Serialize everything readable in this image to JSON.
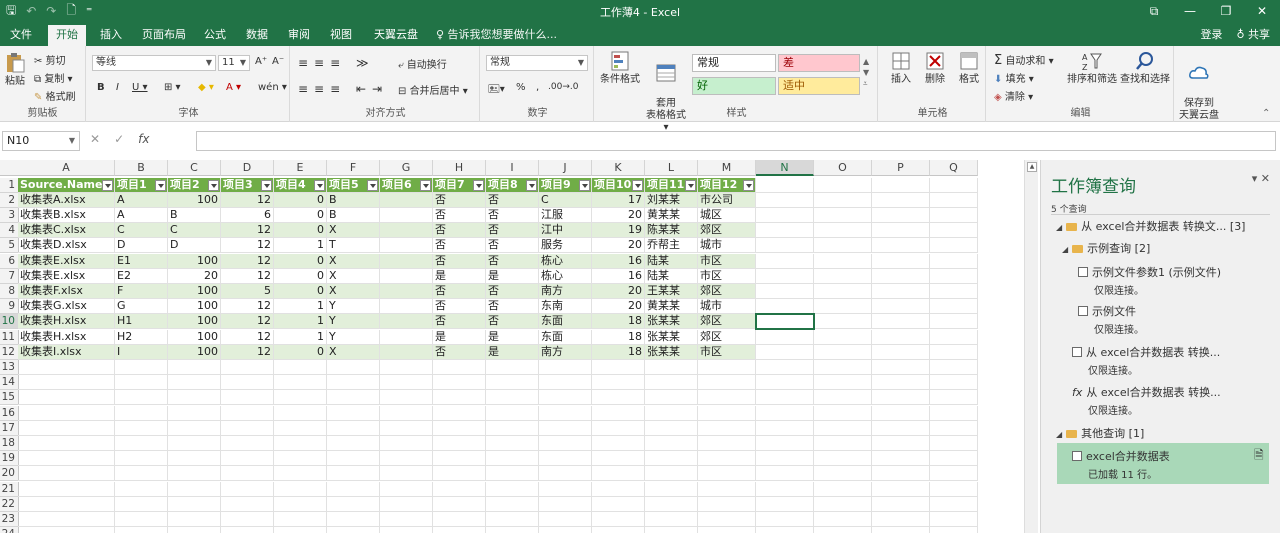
{
  "window": {
    "title": "工作薄4 - Excel"
  },
  "qat": {
    "save": "🖫",
    "undo": "↶",
    "redo": "↷",
    "new": "🗋",
    "more": "⁼"
  },
  "window_buttons": [
    "⧉",
    "—",
    "❐",
    "✕"
  ],
  "tabs": [
    "文件",
    "开始",
    "插入",
    "页面布局",
    "公式",
    "数据",
    "审阅",
    "视图",
    "天翼云盘"
  ],
  "active_tab": "开始",
  "tellme": "♀ 告诉我您想要做什么...",
  "account": {
    "login": "登录",
    "share": "♁ 共享"
  },
  "ribbon": {
    "clipboard": {
      "paste": "粘贴",
      "cut": "剪切",
      "copy": "复制 ▾",
      "painter": "格式刷",
      "label": "剪贴板"
    },
    "font": {
      "name": "等线",
      "size": "11",
      "grow": "A⁺",
      "shrink": "A⁻",
      "bold": "B",
      "italic": "I",
      "underline": "U ▾",
      "border": "⊞ ▾",
      "fill": "◆ ▾",
      "color": "A ▾",
      "wen": "wén ▾",
      "label": "字体"
    },
    "align": {
      "wrap": "自动换行",
      "merge": "合并后居中 ▾",
      "label": "对齐方式"
    },
    "number": {
      "format": "常规",
      "pct": "%",
      "comma": ",",
      "inc": ".00→.0",
      "label": "数字"
    },
    "styles": {
      "cond": "条件格式",
      "table": "套用\n表格格式 ▾",
      "normal": "常规",
      "bad": "差",
      "good": "好",
      "neutral": "适中",
      "label": "样式"
    },
    "cells": {
      "insert": "插入",
      "delete": "删除",
      "format": "格式",
      "label": "单元格"
    },
    "editing": {
      "autosum": "自动求和 ▾",
      "fill": "填充 ▾",
      "clear": "清除 ▾",
      "sort": "排序和筛选",
      "find": "查找和选择",
      "label": "编辑"
    },
    "cloud": {
      "save": "保存到\n天翼云盘"
    }
  },
  "formula_bar": {
    "name_box": "N10",
    "cancel": "✕",
    "enter": "✓",
    "fx": "fx",
    "value": ""
  },
  "grid": {
    "columns": [
      "A",
      "B",
      "C",
      "D",
      "E",
      "F",
      "G",
      "H",
      "I",
      "J",
      "K",
      "L",
      "M",
      "N",
      "O",
      "P",
      "Q"
    ],
    "selected_column": "N",
    "selected_row": 10,
    "row_numbers": [
      1,
      2,
      3,
      4,
      5,
      6,
      7,
      8,
      9,
      10,
      11,
      12,
      13,
      14,
      15,
      16,
      17,
      18,
      19,
      20,
      21,
      22,
      23,
      24
    ],
    "headers": [
      "Source.Name",
      "项目1",
      "项目2",
      "项目3",
      "项目4",
      "项目5",
      "项目6",
      "项目7",
      "项目8",
      "项目9",
      "项目10",
      "项目11",
      "项目12"
    ],
    "rows": [
      [
        "收集表A.xlsx",
        "A",
        "100",
        "12",
        "0",
        "B",
        "",
        "否",
        "否",
        "C",
        "17",
        "刘某某",
        "市公司"
      ],
      [
        "收集表B.xlsx",
        "A",
        "B",
        "6",
        "0",
        "B",
        "",
        "否",
        "否",
        "江服",
        "20",
        "黄某某",
        "城区"
      ],
      [
        "收集表C.xlsx",
        "C",
        "C",
        "12",
        "0",
        "X",
        "",
        "否",
        "否",
        "江中",
        "19",
        "陈某某",
        "郊区"
      ],
      [
        "收集表D.xlsx",
        "D",
        "D",
        "12",
        "1",
        "T",
        "",
        "否",
        "否",
        "服务",
        "20",
        "乔帮主",
        "城市"
      ],
      [
        "收集表E.xlsx",
        "E1",
        "100",
        "12",
        "0",
        "X",
        "",
        "否",
        "否",
        "栋心",
        "16",
        "陆某",
        "市区"
      ],
      [
        "收集表E.xlsx",
        "E2",
        "20",
        "12",
        "0",
        "X",
        "",
        "是",
        "是",
        "栋心",
        "16",
        "陆某",
        "市区"
      ],
      [
        "收集表F.xlsx",
        "F",
        "100",
        "5",
        "0",
        "X",
        "",
        "否",
        "否",
        "南方",
        "20",
        "王某某",
        "郊区"
      ],
      [
        "收集表G.xlsx",
        "G",
        "100",
        "12",
        "1",
        "Y",
        "",
        "否",
        "否",
        "东南",
        "20",
        "黄某某",
        "城市"
      ],
      [
        "收集表H.xlsx",
        "H1",
        "100",
        "12",
        "1",
        "Y",
        "",
        "否",
        "否",
        "东面",
        "18",
        "张某某",
        "郊区"
      ],
      [
        "收集表H.xlsx",
        "H2",
        "100",
        "12",
        "1",
        "Y",
        "",
        "是",
        "是",
        "东面",
        "18",
        "张某某",
        "郊区"
      ],
      [
        "收集表I.xlsx",
        "I",
        "100",
        "12",
        "0",
        "X",
        "",
        "否",
        "是",
        "南方",
        "18",
        "张某某",
        "市区"
      ]
    ]
  },
  "pane": {
    "title": "工作簿查询",
    "controls": "▾ ✕",
    "count": "5 个查询",
    "items": [
      {
        "label": "从 excel合并数据表 转换文... [3]",
        "kind": "folder"
      },
      {
        "label": "示例查询 [2]",
        "kind": "folder"
      },
      {
        "label": "示例文件参数1 (示例文件)",
        "sub": "仅限连接。",
        "kind": "param"
      },
      {
        "label": "示例文件",
        "sub": "仅限连接。",
        "kind": "query"
      },
      {
        "label": "从 excel合并数据表 转换...",
        "sub": "仅限连接。",
        "kind": "table"
      },
      {
        "label": "从 excel合并数据表 转换...",
        "sub": "仅限连接。",
        "kind": "fx"
      },
      {
        "label": "其他查询 [1]",
        "kind": "folder"
      },
      {
        "label": "excel合并数据表",
        "sub": "已加载 11 行。",
        "kind": "table"
      }
    ]
  }
}
